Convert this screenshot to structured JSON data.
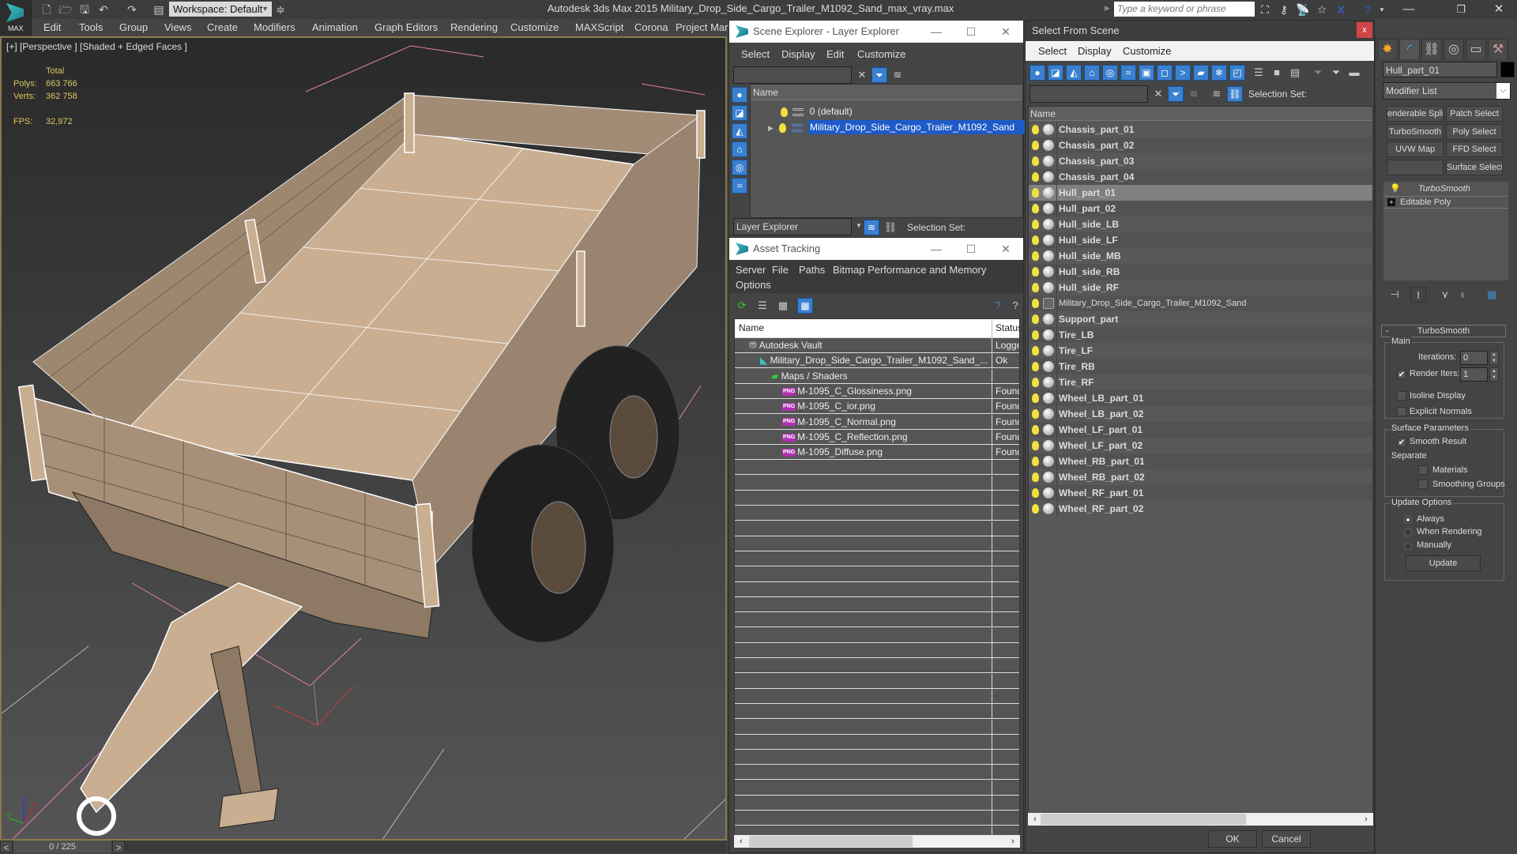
{
  "app": {
    "logo_label": "MAX",
    "title": "Autodesk 3ds Max  2015    Military_Drop_Side_Cargo_Trailer_M1092_Sand_max_vray.max",
    "workspace": "Workspace: Default",
    "search_placeholder": "Type a keyword or phrase"
  },
  "menubar": [
    "Edit",
    "Tools",
    "Group",
    "Views",
    "Create",
    "Modifiers",
    "Animation",
    "Graph Editors",
    "Rendering",
    "Customize",
    "MAXScript",
    "Corona",
    "Project Man"
  ],
  "viewport": {
    "label": "[+] [Perspective ] [Shaded + Edged Faces ]",
    "stats_header": "Total",
    "polys_label": "Polys:",
    "polys_value": "663 766",
    "verts_label": "Verts:",
    "verts_value": "362 758",
    "fps_label": "FPS:",
    "fps_value": "32,972",
    "axis_labels": {
      "x": "x",
      "y": "y",
      "z": "z"
    }
  },
  "timeslider": {
    "value": "0 / 225",
    "prev": "<",
    "next": ">"
  },
  "scene_explorer": {
    "title": "Scene Explorer - Layer Explorer",
    "menu": [
      "Select",
      "Display",
      "Edit",
      "Customize"
    ],
    "column": "Name",
    "layers": [
      {
        "name": "0 (default)",
        "selected": false
      },
      {
        "name": "Military_Drop_Side_Cargo_Trailer_M1092_Sand",
        "selected": true
      }
    ],
    "footer_dropdown": "Layer Explorer",
    "selection_set_label": "Selection Set:"
  },
  "asset_tracking": {
    "title": "Asset Tracking",
    "menu": [
      "Server",
      "File",
      "Paths",
      "Bitmap Performance and Memory",
      "Options"
    ],
    "columns": [
      "Name",
      "Status"
    ],
    "rows": [
      {
        "name": "Autodesk Vault",
        "status": "Logged",
        "indent": 1,
        "icon": "vault-icon"
      },
      {
        "name": "Military_Drop_Side_Cargo_Trailer_M1092_Sand_...",
        "status": "Ok",
        "indent": 2,
        "icon": "max-file-icon"
      },
      {
        "name": "Maps / Shaders",
        "status": "",
        "indent": 3,
        "icon": "maps-icon"
      },
      {
        "name": "M-1095_C_Glossiness.png",
        "status": "Found",
        "indent": 4,
        "icon": "png-icon"
      },
      {
        "name": "M-1095_C_ior.png",
        "status": "Found",
        "indent": 4,
        "icon": "png-icon"
      },
      {
        "name": "M-1095_C_Normal.png",
        "status": "Found",
        "indent": 4,
        "icon": "png-icon"
      },
      {
        "name": "M-1095_C_Reflection.png",
        "status": "Found",
        "indent": 4,
        "icon": "png-icon"
      },
      {
        "name": "M-1095_Diffuse.png",
        "status": "Found",
        "indent": 4,
        "icon": "png-icon"
      }
    ]
  },
  "select_from_scene": {
    "title": "Select From Scene",
    "close": "x",
    "menu": [
      "Select",
      "Display",
      "Customize"
    ],
    "selection_set_label": "Selection Set:",
    "column": "Name",
    "objects": [
      {
        "name": "Chassis_part_01"
      },
      {
        "name": "Chassis_part_02"
      },
      {
        "name": "Chassis_part_03"
      },
      {
        "name": "Chassis_part_04"
      },
      {
        "name": "Hull_part_01",
        "selected": true
      },
      {
        "name": "Hull_part_02"
      },
      {
        "name": "Hull_side_LB"
      },
      {
        "name": "Hull_side_LF"
      },
      {
        "name": "Hull_side_MB"
      },
      {
        "name": "Hull_side_RB"
      },
      {
        "name": "Hull_side_RF"
      },
      {
        "name": "Military_Drop_Side_Cargo_Trailer_M1092_Sand",
        "group": true
      },
      {
        "name": "Support_part"
      },
      {
        "name": "Tire_LB"
      },
      {
        "name": "Tire_LF"
      },
      {
        "name": "Tire_RB"
      },
      {
        "name": "Tire_RF"
      },
      {
        "name": "Wheel_LB_part_01"
      },
      {
        "name": "Wheel_LB_part_02"
      },
      {
        "name": "Wheel_LF_part_01"
      },
      {
        "name": "Wheel_LF_part_02"
      },
      {
        "name": "Wheel_RB_part_01"
      },
      {
        "name": "Wheel_RB_part_02"
      },
      {
        "name": "Wheel_RF_part_01"
      },
      {
        "name": "Wheel_RF_part_02"
      }
    ],
    "ok": "OK",
    "cancel": "Cancel"
  },
  "command_panel": {
    "object_name": "Hull_part_01",
    "object_color": "#000000",
    "modifier_list": "Modifier List",
    "modifier_buttons": [
      "enderable Splin",
      "Patch Select",
      "TurboSmooth",
      "Poly Select",
      "UVW Map",
      "FFD Select",
      "",
      "Surface Select"
    ],
    "stack": [
      "TurboSmooth",
      "Editable Poly"
    ],
    "rollout": {
      "title": "TurboSmooth",
      "collapse": "-",
      "main_label": "Main",
      "iterations_label": "Iterations:",
      "iterations_value": "0",
      "render_iters_label": "Render Iters:",
      "render_iters_value": "1",
      "render_iters_checked": true,
      "isoline_label": "Isoline Display",
      "isoline_checked": false,
      "explicit_normals_label": "Explicit Normals",
      "explicit_normals_checked": false,
      "surface_label": "Surface Parameters",
      "smooth_result_label": "Smooth Result",
      "smooth_result_checked": true,
      "separate_label": "Separate",
      "materials_label": "Materials",
      "materials_checked": false,
      "smoothing_groups_label": "Smoothing Groups",
      "smoothing_groups_checked": false,
      "update_options_label": "Update Options",
      "update_options": [
        "Always",
        "When Rendering",
        "Manually"
      ],
      "update_selected": "Always",
      "update_button": "Update"
    }
  },
  "colors": {
    "accent_blue": "#3a80d0",
    "selection_blue": "#1e5ac8",
    "stat_yellow": "#d8c860",
    "model_sand": "#c9ae91",
    "close_red": "#d04545"
  }
}
